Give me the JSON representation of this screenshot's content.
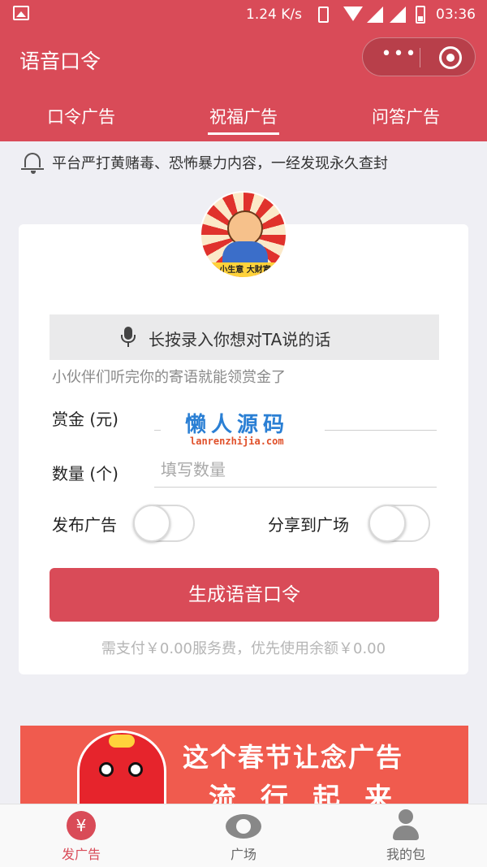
{
  "status_bar": {
    "speed": "1.24 K/s",
    "time": "03:36"
  },
  "header": {
    "title": "语音口令",
    "more_label": "•••",
    "tabs": [
      {
        "label": "口令广告"
      },
      {
        "label": "祝福广告",
        "active": true
      },
      {
        "label": "问答广告"
      }
    ]
  },
  "notice": {
    "text": "平台严打黄赌毒、恐怖暴力内容，一经发现永久查封"
  },
  "card": {
    "avatar_slogan": "小生意 大财富",
    "record_label": "长按录入你想对TA说的话",
    "hint": "小伙伴们听完你的寄语就能领赏金了",
    "reward_label": "赏金 (元)",
    "quantity_label": "数量 (个)",
    "quantity_placeholder": "填写数量",
    "publish_label": "发布广告",
    "publish_on": false,
    "share_label": "分享到广场",
    "share_on": false,
    "generate_label": "生成语音口令",
    "pay_note": "需支付￥0.00服务费，优先使用余额￥0.00"
  },
  "watermark": {
    "title": "懒人源码",
    "url": "lanrenzhijia.com"
  },
  "banner": {
    "line1": "这个春节让念广告",
    "line2": "流行起来"
  },
  "bottom_nav": {
    "items": [
      {
        "label": "发广告",
        "icon": "yen-icon",
        "active": true
      },
      {
        "label": "广场",
        "icon": "eye-icon"
      },
      {
        "label": "我的包",
        "icon": "user-icon"
      }
    ]
  },
  "colors": {
    "brand": "#d94b58",
    "background": "#efeff4"
  }
}
